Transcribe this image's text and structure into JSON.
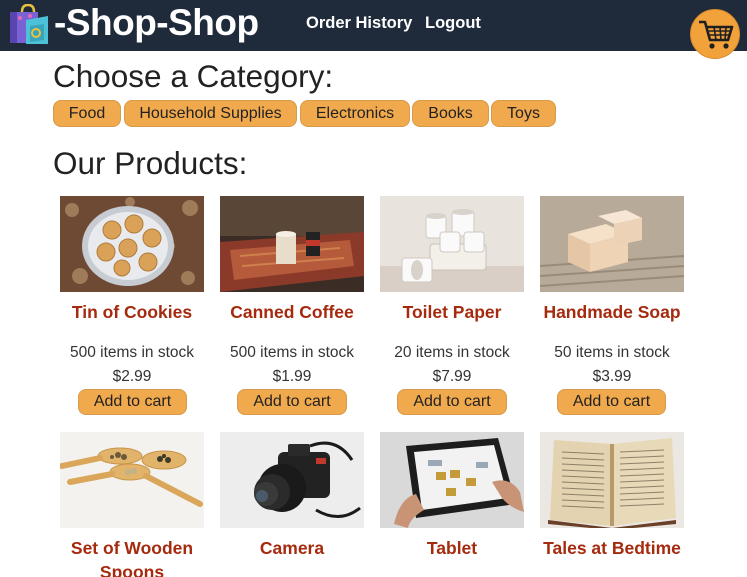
{
  "header": {
    "brand": "-Shop-Shop",
    "nav": [
      {
        "label": "Order History"
      },
      {
        "label": "Logout"
      }
    ]
  },
  "categories": {
    "title": "Choose a Category:",
    "items": [
      {
        "label": "Food"
      },
      {
        "label": "Household Supplies"
      },
      {
        "label": "Electronics"
      },
      {
        "label": "Books"
      },
      {
        "label": "Toys"
      }
    ]
  },
  "products": {
    "title": "Our Products:",
    "button_label": "Add to cart",
    "items": [
      {
        "name": "Tin of Cookies",
        "stock": "500 items in stock",
        "price": "$2.99",
        "image": "cookies"
      },
      {
        "name": "Canned Coffee",
        "stock": "500 items in stock",
        "price": "$1.99",
        "image": "coffee"
      },
      {
        "name": "Toilet Paper",
        "stock": "20 items in stock",
        "price": "$7.99",
        "image": "toilet-paper"
      },
      {
        "name": "Handmade Soap",
        "stock": "50 items in stock",
        "price": "$3.99",
        "image": "soap"
      },
      {
        "name": "Set of Wooden Spoons",
        "image": "spoons"
      },
      {
        "name": "Camera",
        "image": "camera"
      },
      {
        "name": "Tablet",
        "image": "tablet"
      },
      {
        "name": "Tales at Bedtime",
        "image": "book"
      }
    ]
  },
  "colors": {
    "header_bg": "#1f2a3a",
    "accent": "#f1a94d",
    "product_name": "#a52a0e"
  }
}
